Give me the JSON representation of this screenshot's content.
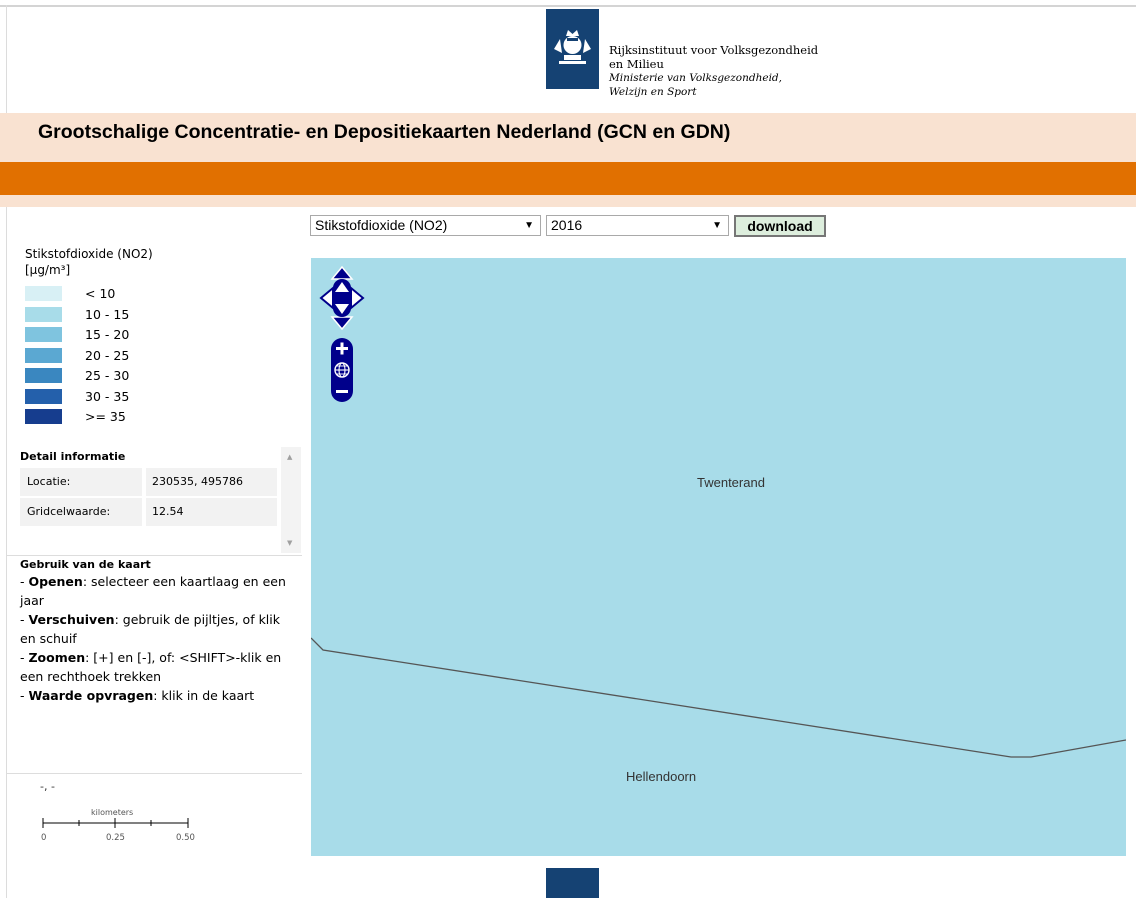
{
  "header": {
    "org_line1": "Rijksinstituut voor Volksgezondheid",
    "org_line2": "en Milieu",
    "ministry_line1": "Ministerie van Volksgezondheid,",
    "ministry_line2": "Welzijn en Sport",
    "title": "Grootschalige Concentratie- en Depositiekaarten Nederland (GCN en GDN)"
  },
  "controls": {
    "layer_select": "Stikstofdioxide (NO2)",
    "year_select": "2016",
    "download_label": "download"
  },
  "legend": {
    "title": "Stikstofdioxide (NO2)\n[µg/m³]",
    "items": [
      {
        "label": "< 10",
        "color": "#d8f0f5"
      },
      {
        "label": "10 - 15",
        "color": "#a8dce9"
      },
      {
        "label": "15 - 20",
        "color": "#7fc4df"
      },
      {
        "label": "20 - 25",
        "color": "#5ba8d2"
      },
      {
        "label": "25 - 30",
        "color": "#3a87c0"
      },
      {
        "label": "30 - 35",
        "color": "#2460ab"
      },
      {
        "label": ">= 35",
        "color": "#163d8e"
      }
    ]
  },
  "detail": {
    "heading": "Detail informatie",
    "rows": [
      {
        "key": "Locatie:",
        "value": "230535, 495786"
      },
      {
        "key": "Gridcelwaarde:",
        "value": "12.54"
      }
    ]
  },
  "usage": {
    "heading": "Gebruik van de kaart",
    "items": [
      {
        "bold": "Openen",
        "text": ": selecteer een kaartlaag en een jaar"
      },
      {
        "bold": "Verschuiven",
        "text": ": gebruik de pijltjes, of klik en schuif"
      },
      {
        "bold": "Zoomen",
        "text": ": [+] en [-], of: <SHIFT>-klik en een rechthoek trekken"
      },
      {
        "bold": "Waarde opvragen",
        "text": ": klik in de kaart"
      }
    ]
  },
  "coordinates": "-, -",
  "scale": {
    "unit": "kilometers",
    "ticks": [
      "0",
      "0.25",
      "0.50"
    ]
  },
  "map": {
    "places": [
      "Twenterand",
      "Hellendoorn"
    ],
    "background": "#a8dce9"
  },
  "colors": {
    "brand_blue": "#154273",
    "orange": "#e17000",
    "peach": "#f9e2d1"
  }
}
